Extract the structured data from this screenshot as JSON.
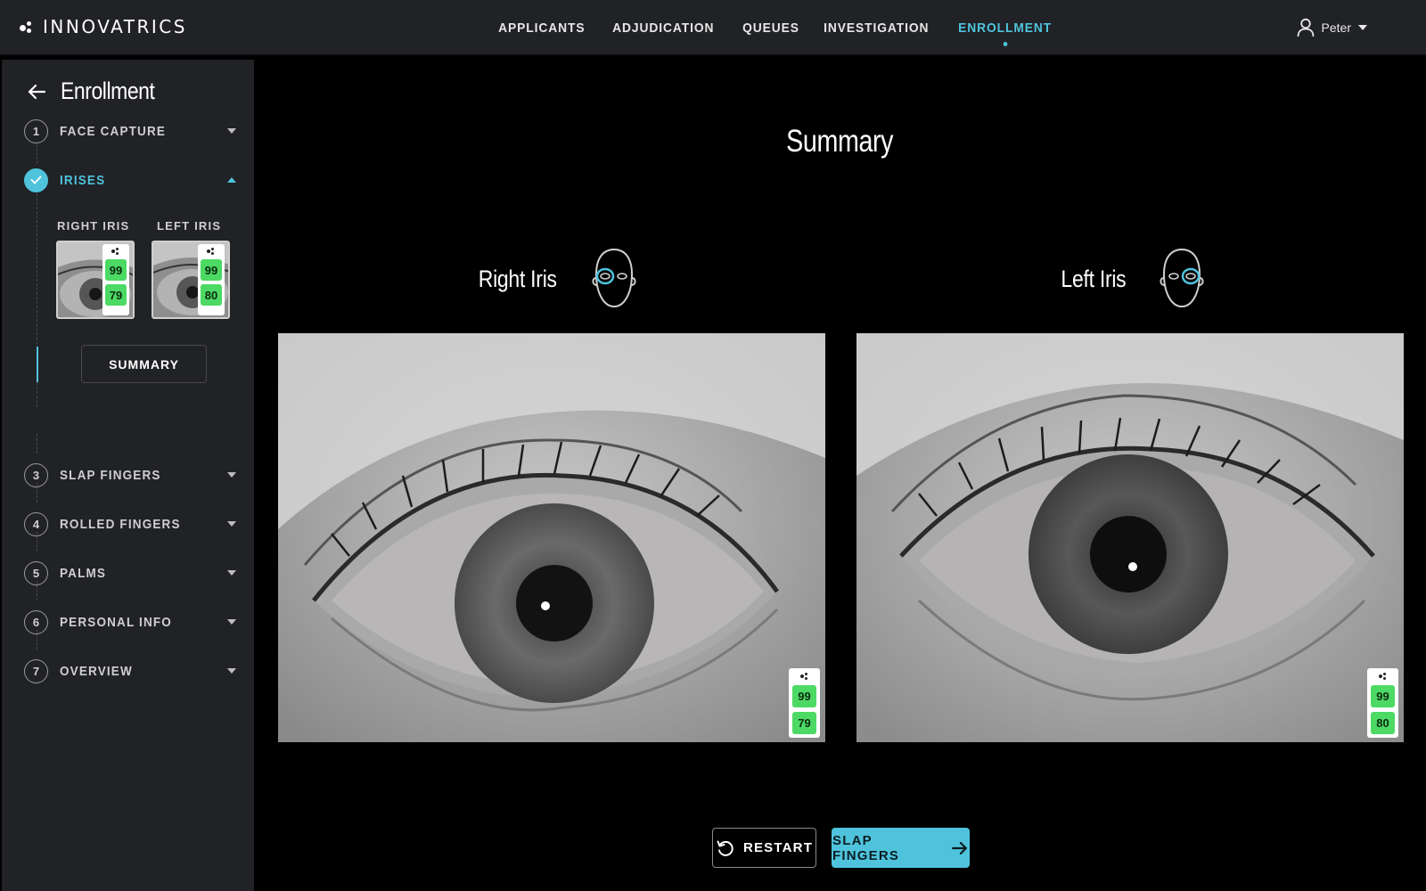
{
  "app": {
    "brand": "INNOVATRICS"
  },
  "nav": {
    "items": [
      {
        "label": "APPLICANTS"
      },
      {
        "label": "ADJUDICATION"
      },
      {
        "label": "QUEUES"
      },
      {
        "label": "INVESTIGATION"
      },
      {
        "label": "ENROLLMENT"
      }
    ],
    "active": "ENROLLMENT"
  },
  "user": {
    "name": "Peter"
  },
  "sidebar": {
    "title": "Enrollment",
    "steps": [
      {
        "num": "1",
        "label": "FACE CAPTURE",
        "state": "collapsed"
      },
      {
        "num": "",
        "label": "IRISES",
        "state": "expanded-done"
      },
      {
        "num": "3",
        "label": "SLAP FINGERS",
        "state": "collapsed"
      },
      {
        "num": "4",
        "label": "ROLLED FINGERS",
        "state": "collapsed"
      },
      {
        "num": "5",
        "label": "PALMS",
        "state": "collapsed"
      },
      {
        "num": "6",
        "label": "PERSONAL INFO",
        "state": "collapsed"
      },
      {
        "num": "7",
        "label": "OVERVIEW",
        "state": "collapsed"
      }
    ],
    "thumbs": [
      {
        "label": "RIGHT IRIS",
        "scores": [
          "99",
          "79"
        ]
      },
      {
        "label": "LEFT IRIS",
        "scores": [
          "99",
          "80"
        ]
      }
    ],
    "summary_label": "SUMMARY"
  },
  "main": {
    "title": "Summary",
    "right_iris": {
      "title": "Right Iris",
      "scores": [
        "99",
        "79"
      ]
    },
    "left_iris": {
      "title": "Left Iris",
      "scores": [
        "99",
        "80"
      ]
    }
  },
  "footer": {
    "restart_label": "RESTART",
    "next_label": "SLAP FINGERS"
  },
  "colors": {
    "accent": "#4fc3dc",
    "score_good": "#4cd964",
    "panel": "#212226"
  }
}
